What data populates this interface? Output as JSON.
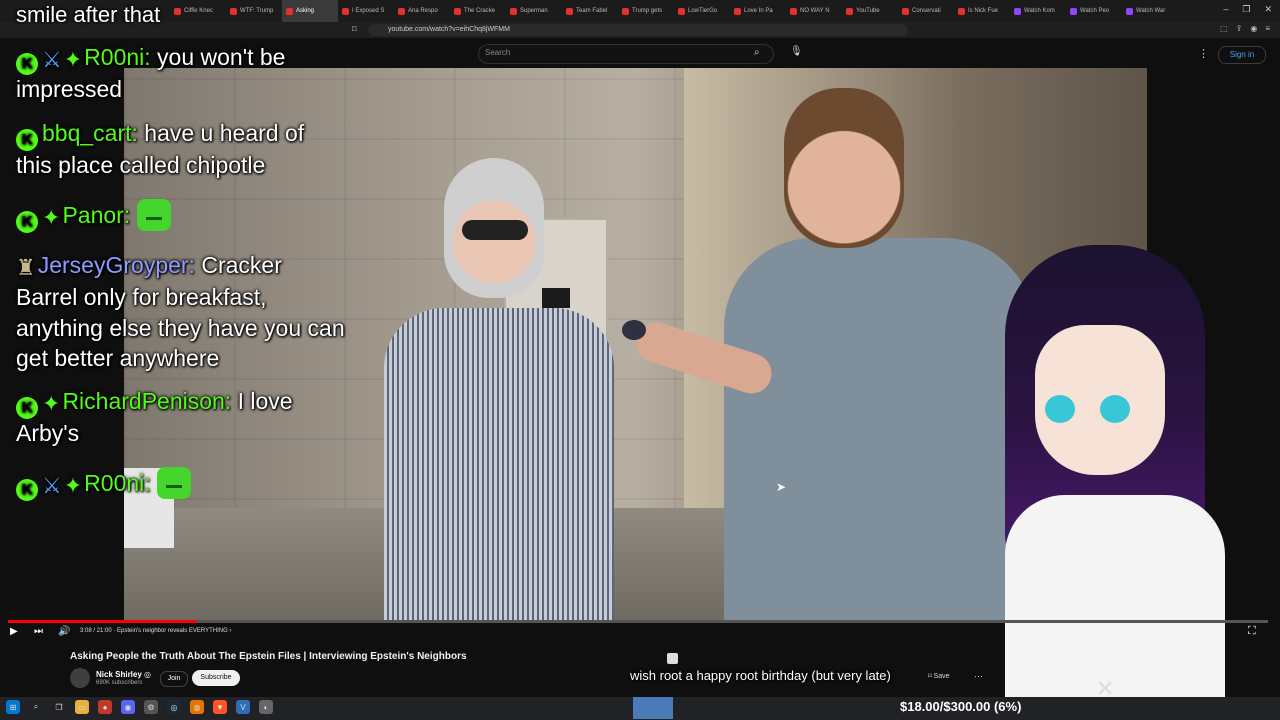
{
  "browser": {
    "tabs": [
      "Ciffie Knec",
      "WTF: Trump",
      "Asking",
      "I Exposed S",
      "Ana Respo",
      "The Cracke",
      "Superman",
      "Team Fabel",
      "Trump gets",
      "LowTierGo",
      "Love In Pa",
      "NO WAY N",
      "YouTube",
      "Conservati",
      "Is Nick Fue",
      "Watch Kom",
      "Watch Peo",
      "Watch War"
    ],
    "active_tab_index": 2,
    "url": "youtube.com/watch?v=eihChq8jWFMM",
    "window_controls": [
      "–",
      "❐",
      "✕"
    ]
  },
  "youtube": {
    "search_placeholder": "Search",
    "sign_in": "Sign in",
    "video_title": "Asking People the Truth About The Epstein Files | Interviewing Epstein's Neighbors",
    "channel_name": "Nick Shirley ◎",
    "subscribers": "690K subscribers",
    "join_label": "Join",
    "subscribe_label": "Subscribe",
    "save_label": "Save",
    "more_label": "···",
    "timecode": "3:08 / 21:00 · Epstein's neighbor reveals EVERYTHING ›",
    "progress": 0.15
  },
  "chat": {
    "overlay_title": "smile after that",
    "messages": [
      {
        "user": "R00ni:",
        "text": "you won't be",
        "continuation": "impressed",
        "badges": [
          "k",
          "sword",
          "diamond"
        ],
        "name_color": "green"
      },
      {
        "user": "bbq_cart:",
        "text": "have u heard of",
        "continuation": "this place called chipotle",
        "badges": [
          "k"
        ],
        "name_color": "green"
      },
      {
        "user": "Panor:",
        "text": "",
        "continuation": "",
        "badges": [
          "k",
          "diamond"
        ],
        "name_color": "green",
        "emote": true
      },
      {
        "user": "JerseyGroyper:",
        "text": "Cracker",
        "continuation": "Barrel only for breakfast, anything else they have you can get better anywhere",
        "badges": [
          "bottle"
        ],
        "name_color": "blue"
      },
      {
        "user": "RichardPenison:",
        "text": "I love",
        "continuation": "Arby's",
        "badges": [
          "k",
          "diamond"
        ],
        "name_color": "green"
      },
      {
        "user": "R00ni:",
        "text": "",
        "continuation": "",
        "badges": [
          "k",
          "sword",
          "diamond"
        ],
        "name_color": "green",
        "emote": true
      }
    ],
    "continuation_lines": {
      "jersey_1": "Barrel only for breakfast,",
      "jersey_2": "anything else they have you can",
      "jersey_3": "get better anywhere"
    }
  },
  "stream": {
    "ticker": "wish root a happy root birthday (but very late)",
    "goal": "$18.00/$300.00 (6%)",
    "badge_k": "K"
  },
  "colors": {
    "kick_green": "#53fc18",
    "yt_red": "#ff0000",
    "link_blue": "#3ea6ff"
  }
}
